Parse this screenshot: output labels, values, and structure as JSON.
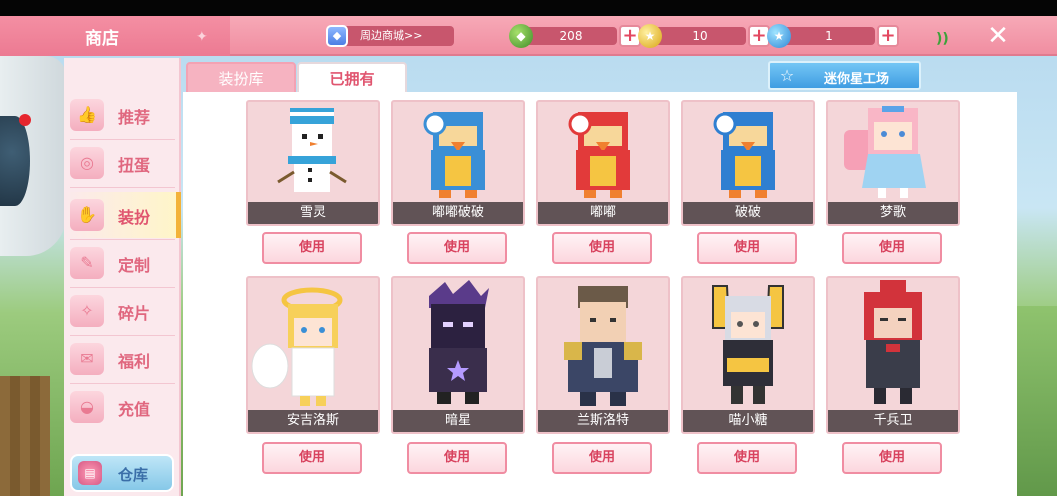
{
  "header": {
    "title": "商店",
    "mall_label": "周边商城>>",
    "currencies": [
      {
        "icon": "green-gem-icon",
        "value": "208"
      },
      {
        "icon": "gold-coin-icon",
        "value": "10"
      },
      {
        "icon": "blue-star-coin-icon",
        "value": "1"
      }
    ]
  },
  "sidebar": {
    "items": [
      {
        "label": "推荐",
        "icon": "thumbs-up-icon"
      },
      {
        "label": "扭蛋",
        "icon": "gacha-icon"
      },
      {
        "label": "装扮",
        "icon": "outfit-icon",
        "active": true
      },
      {
        "label": "定制",
        "icon": "custom-icon"
      },
      {
        "label": "碎片",
        "icon": "fragment-icon"
      },
      {
        "label": "福利",
        "icon": "gift-icon"
      },
      {
        "label": "充值",
        "icon": "recharge-icon"
      }
    ],
    "warehouse_label": "仓库"
  },
  "tabs": {
    "tab1": "装扮库",
    "tab2": "已拥有",
    "studio": "迷你星工场"
  },
  "use_label": "使用",
  "skins": [
    {
      "name": "雪灵"
    },
    {
      "name": "嘟嘟破破"
    },
    {
      "name": "嘟嘟"
    },
    {
      "name": "破破"
    },
    {
      "name": "梦歌"
    },
    {
      "name": "安吉洛斯"
    },
    {
      "name": "暗星"
    },
    {
      "name": "兰斯洛特"
    },
    {
      "name": "喵小糖"
    },
    {
      "name": "千兵卫"
    }
  ],
  "colors": {
    "header_pink": "#f08ea1",
    "accent_red": "#e0556f",
    "studio_blue": "#3f9de2"
  }
}
